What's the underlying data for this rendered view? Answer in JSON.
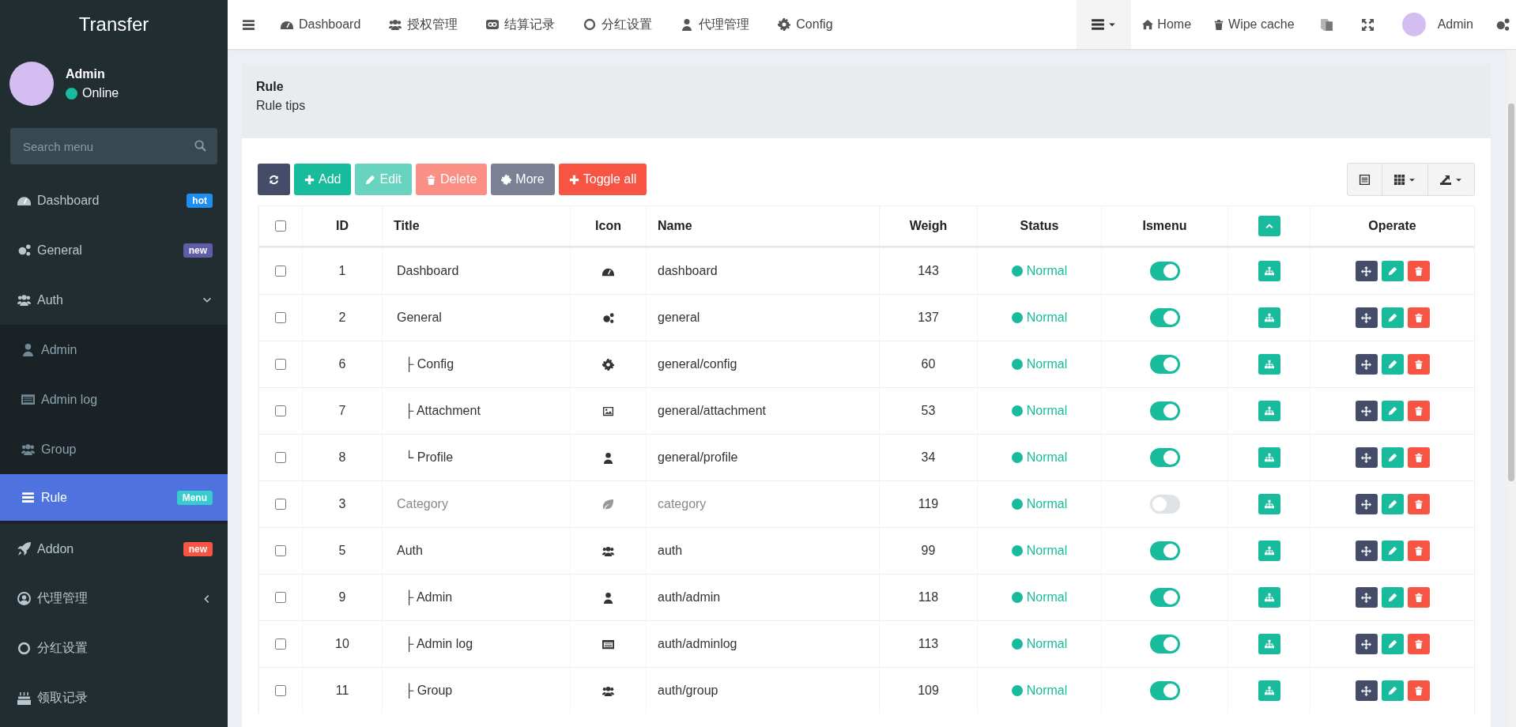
{
  "app": {
    "title": "Transfer"
  },
  "user": {
    "name": "Admin",
    "status": "Online"
  },
  "search": {
    "placeholder": "Search menu"
  },
  "sidebar": {
    "items": [
      {
        "label": "Dashboard",
        "selected": false,
        "badge": {
          "text": "hot",
          "color": "#1f8ef1"
        }
      },
      {
        "label": "General",
        "selected": false,
        "badge": {
          "text": "new",
          "color": "#605ca8"
        }
      },
      {
        "label": "Auth",
        "selected": false,
        "expanded": true,
        "children": [
          {
            "label": "Admin",
            "selected": false
          },
          {
            "label": "Admin log",
            "selected": false
          },
          {
            "label": "Group",
            "selected": false
          },
          {
            "label": "Rule",
            "selected": true,
            "badge": {
              "text": "Menu",
              "color": "#39cccc"
            }
          }
        ]
      },
      {
        "label": "Addon",
        "selected": false,
        "badge": {
          "text": "new",
          "color": "#f75444"
        }
      },
      {
        "label": "代理管理",
        "selected": false,
        "expanded": false
      },
      {
        "label": "分红设置",
        "selected": false
      },
      {
        "label": "领取记录",
        "selected": false
      }
    ]
  },
  "topnav": {
    "items": [
      {
        "label": "Dashboard"
      },
      {
        "label": "授权管理"
      },
      {
        "label": "结算记录"
      },
      {
        "label": "分红设置"
      },
      {
        "label": "代理管理"
      },
      {
        "label": "Config"
      }
    ],
    "right": [
      {
        "label": "Home"
      },
      {
        "label": "Wipe cache"
      }
    ],
    "user": "Admin"
  },
  "header": {
    "title": "Rule",
    "tips": "Rule tips"
  },
  "toolbar": {
    "buttons": [
      {
        "kind": "refresh",
        "disabled": false
      },
      {
        "kind": "add",
        "label": "Add",
        "disabled": false
      },
      {
        "kind": "edit",
        "label": "Edit",
        "disabled": true
      },
      {
        "kind": "delete",
        "label": "Delete",
        "disabled": true
      },
      {
        "kind": "more",
        "label": "More",
        "disabled": false
      },
      {
        "kind": "toggle",
        "label": "Toggle all",
        "disabled": false
      }
    ]
  },
  "table": {
    "select_all": {
      "checked": false
    },
    "columns": [
      "ID",
      "Title",
      "Icon",
      "Name",
      "Weigh",
      "Status",
      "Ismenu",
      "Operate"
    ],
    "rows": [
      {
        "checked": false,
        "id": "1",
        "title": "Dashboard",
        "name": "dashboard",
        "weigh": "143",
        "status": "Normal",
        "ismenu": true
      },
      {
        "checked": false,
        "id": "2",
        "title": "General",
        "name": "general",
        "weigh": "137",
        "status": "Normal",
        "ismenu": true,
        "children": [
          {
            "checked": false,
            "id": "6",
            "title": "├ Config",
            "name": "general/config",
            "weigh": "60",
            "status": "Normal",
            "ismenu": true
          },
          {
            "checked": false,
            "id": "7",
            "title": "├ Attachment",
            "name": "general/attachment",
            "weigh": "53",
            "status": "Normal",
            "ismenu": true
          },
          {
            "checked": false,
            "id": "8",
            "title": "└ Profile",
            "name": "general/profile",
            "weigh": "34",
            "status": "Normal",
            "ismenu": true
          }
        ]
      },
      {
        "checked": false,
        "id": "3",
        "title": "Category",
        "name": "category",
        "weigh": "119",
        "status": "Normal",
        "ismenu": false
      },
      {
        "checked": false,
        "id": "5",
        "title": "Auth",
        "name": "auth",
        "weigh": "99",
        "status": "Normal",
        "ismenu": true,
        "children": [
          {
            "checked": false,
            "id": "9",
            "title": "├ Admin",
            "name": "auth/admin",
            "weigh": "118",
            "status": "Normal",
            "ismenu": true
          },
          {
            "checked": false,
            "id": "10",
            "title": "├ Admin log",
            "name": "auth/adminlog",
            "weigh": "113",
            "status": "Normal",
            "ismenu": true
          },
          {
            "checked": false,
            "id": "11",
            "title": "├ Group",
            "name": "auth/group",
            "weigh": "109",
            "status": "Normal",
            "ismenu": true
          }
        ]
      }
    ]
  }
}
